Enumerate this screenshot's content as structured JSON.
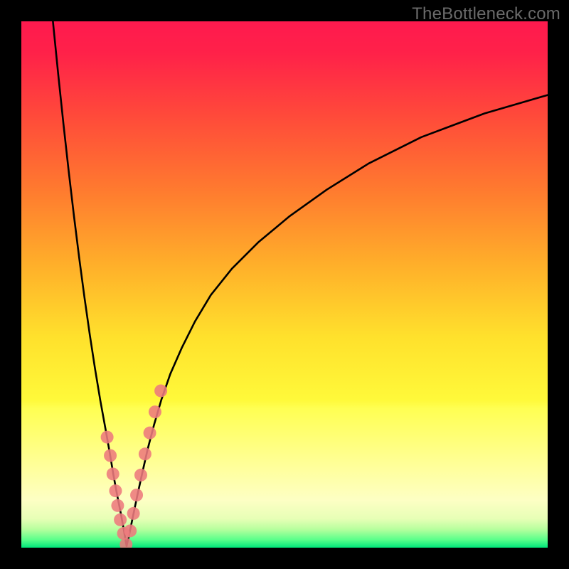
{
  "watermark": "TheBottleneck.com",
  "colors": {
    "frame": "#000000",
    "curve": "#000000",
    "marker_fill": "#ed7a7d",
    "marker_stroke": "#ed7a7d",
    "gradient_stops": [
      {
        "offset": 0.0,
        "color": "#ff1a4e"
      },
      {
        "offset": 0.06,
        "color": "#ff2149"
      },
      {
        "offset": 0.18,
        "color": "#ff4a3a"
      },
      {
        "offset": 0.32,
        "color": "#ff7a2f"
      },
      {
        "offset": 0.46,
        "color": "#ffae2a"
      },
      {
        "offset": 0.6,
        "color": "#ffe12c"
      },
      {
        "offset": 0.72,
        "color": "#fff93a"
      },
      {
        "offset": 0.735,
        "color": "#ffff52"
      },
      {
        "offset": 0.85,
        "color": "#ffff9d"
      },
      {
        "offset": 0.91,
        "color": "#fdffc4"
      },
      {
        "offset": 0.945,
        "color": "#e7ffb6"
      },
      {
        "offset": 0.965,
        "color": "#b7ff9e"
      },
      {
        "offset": 0.985,
        "color": "#59ff8b"
      },
      {
        "offset": 1.0,
        "color": "#00e67a"
      }
    ]
  },
  "chart_data": {
    "type": "line",
    "title": "",
    "xlabel": "",
    "ylabel": "",
    "xlim": [
      0,
      100
    ],
    "ylim": [
      0,
      100
    ],
    "series": [
      {
        "name": "left-branch",
        "x": [
          6,
          7,
          8,
          9,
          10,
          11,
          12,
          13,
          14,
          15,
          16,
          16.8,
          17.5,
          18.2,
          18.9,
          19.5,
          20.0
        ],
        "y": [
          100,
          90,
          80.5,
          71.5,
          63,
          55,
          47.5,
          40.5,
          34,
          28,
          22.5,
          18,
          13.8,
          10,
          6.5,
          3.2,
          0.3
        ]
      },
      {
        "name": "right-branch",
        "x": [
          20.0,
          20.6,
          21.3,
          22.1,
          23.0,
          24.0,
          25.2,
          26.6,
          28.3,
          30.5,
          33.0,
          36.0,
          40.0,
          45.0,
          51.0,
          58.0,
          66.0,
          76.0,
          88.0,
          100.0
        ],
        "y": [
          0.3,
          3.0,
          6.4,
          10.2,
          14.3,
          18.7,
          23.3,
          28.1,
          33.0,
          38.0,
          43.0,
          48.0,
          53.0,
          58.0,
          63.0,
          68.0,
          73.0,
          78.0,
          82.5,
          86.0
        ]
      }
    ],
    "markers": {
      "name": "highlight-dots",
      "x": [
        16.3,
        16.9,
        17.4,
        17.9,
        18.3,
        18.8,
        19.4,
        19.9,
        20.7,
        21.3,
        21.9,
        22.7,
        23.5,
        24.4,
        25.4,
        26.5
      ],
      "y": [
        21.0,
        17.5,
        14.0,
        10.8,
        8.0,
        5.3,
        2.7,
        0.6,
        3.2,
        6.5,
        10.0,
        13.8,
        17.8,
        21.8,
        25.8,
        29.8
      ]
    }
  }
}
